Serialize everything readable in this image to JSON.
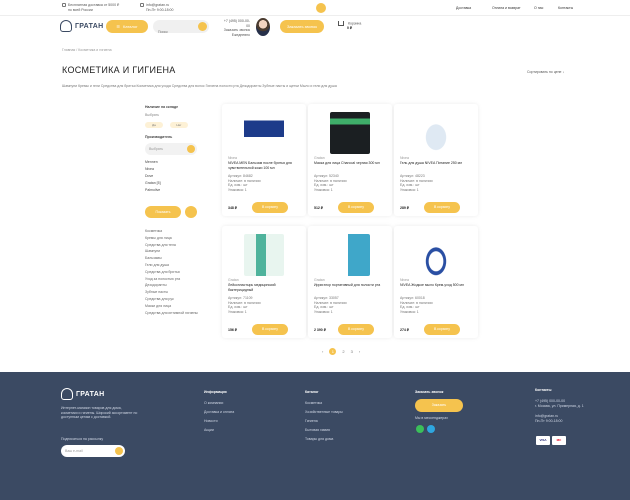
{
  "topbar": {
    "line1": "Бесплатная доставка от 5000 ₽",
    "line2": "по всей России",
    "email": "info@gratan.ru",
    "hours": "Пн-Пт 9:00-18:00",
    "nav": [
      "Доставка",
      "Оплата и возврат",
      "О нас",
      "Контакты"
    ]
  },
  "header": {
    "logo": "ГРАТАН",
    "catalog_label": "Каталог",
    "search_placeholder": "Поиск",
    "phone": "+7 (495) 000-00-00",
    "contact_line": "Заказать звонок",
    "contact_line2": "Ежедневно",
    "callback_label": "Заказать звонок",
    "cart_label": "Корзина",
    "cart_sum": "0 ₽"
  },
  "breadcrumb": "Главная / Косметика и гигиена",
  "page_title": "КОСМЕТИКА И ГИГИЕНА",
  "sort_label": "Сортировать по цене ↓",
  "subcategories": "Шампуни   Кремы и гели   Средства для бритья   Косметика для ухода   Средства для волос   Гигиена полости рта   Дезодоранты   Зубные пасты и щетки   Мыло и гели для душа",
  "filters": {
    "title": "Наличие на складе",
    "subtitle": "Выбрать",
    "chips": [
      "Да",
      "Нет"
    ],
    "brand_title": "Производитель",
    "brand_placeholder": "Выбрать",
    "brands": [
      "Mennen",
      "Nivea",
      "Dove",
      "Gratan [5]",
      "Palmolive"
    ],
    "apply_label": "Показать",
    "categories": [
      "Косметика",
      "Кремы для лица",
      "Средства для тела",
      "Шампуни",
      "Бальзамы",
      "Гели для душа",
      "Средства для бритья",
      "Уход за полостью рта",
      "Дезодоранты",
      "Зубные пасты",
      "Средства для рук",
      "Маски для лица",
      "Средства для интимной гигиены"
    ]
  },
  "products": [
    {
      "brand": "Nivea",
      "name": "NIVEA MEN Бальзам после бритья для чувствительной кожи 100 мл",
      "code": "Артикул: 84682",
      "stock": "Наличие: в наличии",
      "unit": "Ед. изм.: шт",
      "pack": "Упаковка: 1",
      "price": "348 ₽",
      "buy": "В корзину",
      "color": "#1d3b8a"
    },
    {
      "brand": "Gratan",
      "name": "Маска для лица Charcoal черная 300 мл",
      "code": "Артикул: 52340",
      "stock": "Наличие: в наличии",
      "unit": "Ед. изм.: шт",
      "pack": "Упаковка: 1",
      "price": "512 ₽",
      "buy": "В корзину",
      "color": "#1b1f22"
    },
    {
      "brand": "Nivea",
      "name": "Гель для душа NIVEA Питание 250 мл",
      "code": "Артикул: 48223",
      "stock": "Наличие: в наличии",
      "unit": "Ед. изм.: шт",
      "pack": "Упаковка: 1",
      "price": "289 ₽",
      "buy": "В корзину",
      "color": "#dfe9f3"
    },
    {
      "brand": "Gratan",
      "name": "Лейкопластырь медицинский бактерицидный",
      "code": "Артикул: 71109",
      "stock": "Наличие: в наличии",
      "unit": "Ед. изм.: шт",
      "pack": "Упаковка: 1",
      "price": "156 ₽",
      "buy": "В корзину",
      "color": "#4fb39c"
    },
    {
      "brand": "Gratan",
      "name": "Ирригатор портативный для полости рта",
      "code": "Артикул: 33057",
      "stock": "Наличие: в наличии",
      "unit": "Ед. изм.: шт",
      "pack": "Упаковка: 1",
      "price": "2 390 ₽",
      "buy": "В корзину",
      "color": "#3fa7c9"
    },
    {
      "brand": "Nivea",
      "name": "NIVEA Жидкое мыло Крем-уход 500 мл",
      "code": "Артикул: 60018",
      "stock": "Наличие: в наличии",
      "unit": "Ед. изм.: шт",
      "pack": "Упаковка: 1",
      "price": "274 ₽",
      "buy": "В корзину",
      "color": "#2a4fa3"
    }
  ],
  "pagination": {
    "prev": "‹",
    "pages": [
      "1",
      "2",
      "3"
    ],
    "next": "›"
  },
  "footer": {
    "logo": "ГРАТАН",
    "about": "Интернет-магазин товаров для дома, косметики и гигиены. Широкий ассортимент по доступным ценам с доставкой.",
    "subscribe_label": "Подписаться на рассылку",
    "subscribe_placeholder": "Ваш e-mail",
    "col1": {
      "title": "Информация",
      "items": [
        "О компании",
        "Доставка и оплата",
        "Новости",
        "Акции"
      ]
    },
    "col2": {
      "title": "Каталог",
      "items": [
        "Косметика",
        "Хозяйственные товары",
        "Гигиена",
        "Бытовая химия",
        "Товары для дома"
      ]
    },
    "col3": {
      "title": "Заказать звонок",
      "button": "Заказать",
      "note": "Мы в мессенджерах"
    },
    "contacts": {
      "title": "Контакты",
      "lines": [
        "+7 (495) 000-00-00",
        "г. Москва, ул. Примерная, д. 1",
        "",
        "info@gratan.ru",
        "Пн-Пт 9:00-18:00"
      ]
    },
    "pay": [
      "VISA",
      "MC"
    ]
  }
}
